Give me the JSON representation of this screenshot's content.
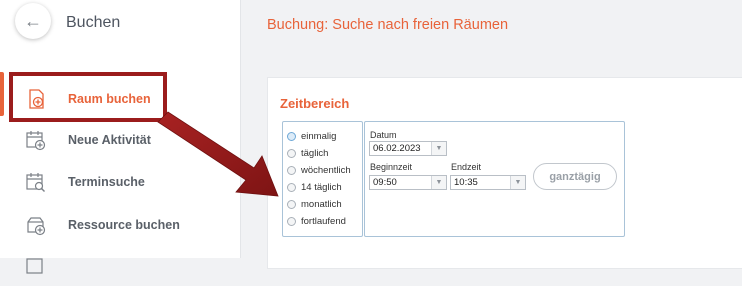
{
  "sidebar": {
    "back_icon": "arrow-left-icon",
    "title": "Buchen",
    "items": [
      {
        "label": "Raum buchen",
        "icon": "calendar-add-icon",
        "active": true
      },
      {
        "label": "Neue Aktivität",
        "icon": "calendar-plus-icon",
        "active": false
      },
      {
        "label": "Terminsuche",
        "icon": "calendar-search-icon",
        "active": false
      },
      {
        "label": "Ressource buchen",
        "icon": "resource-add-icon",
        "active": false
      }
    ]
  },
  "main": {
    "title": "Buchung: Suche nach freien Räumen",
    "section_title": "Zeitbereich",
    "recurrence": {
      "options": [
        "einmalig",
        "täglich",
        "wöchentlich",
        "14 täglich",
        "monatlich",
        "fortlaufend"
      ],
      "selected": "einmalig"
    },
    "date": {
      "label": "Datum",
      "value": "06.02.2023"
    },
    "start_time": {
      "label": "Beginnzeit",
      "value": "09:50"
    },
    "end_time": {
      "label": "Endzeit",
      "value": "10:35"
    },
    "all_day_label": "ganztägig"
  },
  "colors": {
    "accent": "#e8633a",
    "annotation": "#9b1c1c"
  }
}
